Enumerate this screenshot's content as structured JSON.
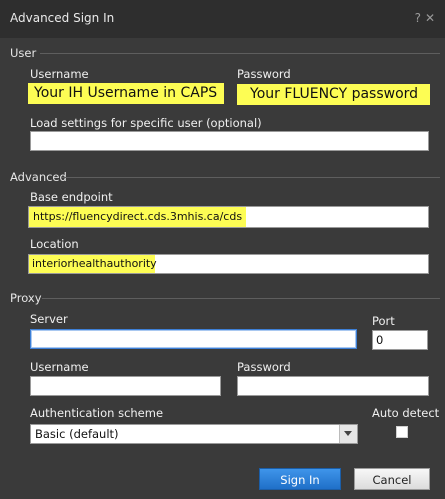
{
  "window": {
    "title": "Advanced Sign In",
    "help_glyph": "?",
    "close_glyph": "✕"
  },
  "user_group": {
    "label": "User",
    "username_label": "Username",
    "username_value": "Your IH Username in CAPS",
    "password_label": "Password",
    "password_value": "Your FLUENCY password",
    "load_settings_label": "Load settings for specific user (optional)",
    "load_settings_value": ""
  },
  "advanced_group": {
    "label": "Advanced",
    "base_endpoint_label": "Base endpoint",
    "base_endpoint_value": "https://fluencydirect.cds.3mhis.ca/cds",
    "location_label": "Location",
    "location_value": "interiorhealthauthority"
  },
  "proxy_group": {
    "label": "Proxy",
    "server_label": "Server",
    "server_value": "",
    "port_label": "Port",
    "port_value": "0",
    "username_label": "Username",
    "username_value": "",
    "password_label": "Password",
    "password_value": "",
    "auth_scheme_label": "Authentication scheme",
    "auth_scheme_value": "Basic (default)",
    "auto_detect_label": "Auto detect"
  },
  "buttons": {
    "sign_in_label": "Sign In",
    "cancel_label": "Cancel"
  },
  "colors": {
    "highlight": "#fdfd54",
    "dialog_bg": "#3a3a3a",
    "primary_button": "#2a82dd"
  }
}
